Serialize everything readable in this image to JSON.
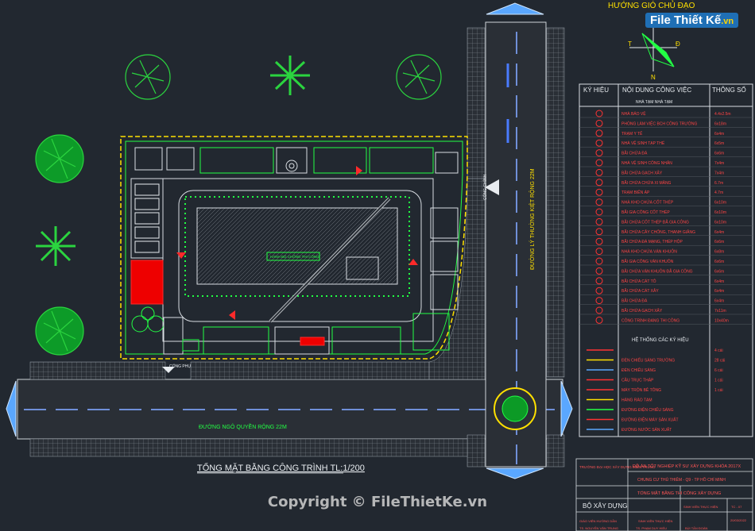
{
  "compass": {
    "title": "HƯỚNG GIÓ CHỦ ĐẠO",
    "west": "T",
    "east": "Đ",
    "south": "N"
  },
  "brand": {
    "name": "File Thiết Kế",
    "suffix": ".vn"
  },
  "legend": {
    "headers": [
      "KÝ HIỆU",
      "NỘI DUNG CÔNG VIỆC",
      "THÔNG SỐ"
    ],
    "subheader": "NHÀ TẠM NHÀ TẠM",
    "rows": [
      {
        "label": "NHÀ BẢO VỆ",
        "value": "4.4x2.5m"
      },
      {
        "label": "PHÒNG LÀM VIỆC BCH CÔNG TRƯỜNG",
        "value": "6x18m"
      },
      {
        "label": "TRẠM Y TẾ",
        "value": "6x4m"
      },
      {
        "label": "NHÀ VỆ SINH TẠP THỂ",
        "value": "6x5m"
      },
      {
        "label": "BÃI CHỨA ĐÁ",
        "value": "6x6m"
      },
      {
        "label": "NHÀ VỆ SINH CÔNG NHÂN",
        "value": "7x4m"
      },
      {
        "label": "BÃI CHỨA GẠCH XÂY",
        "value": "7x4m"
      },
      {
        "label": "BÃI CHỨA CHỨA XI MĂNG",
        "value": "6.7m"
      },
      {
        "label": "TRẠM BIẾN ÁP",
        "value": "4.7m"
      },
      {
        "label": "NHÀ KHO CHỨA CỐT THÉP",
        "value": "6x10m"
      },
      {
        "label": "BÃI GIA CÔNG CỐT THÉP",
        "value": "6x10m"
      },
      {
        "label": "BÃI CHỨA CỐT THÉP ĐÃ GIA CÔNG",
        "value": "6x10m"
      },
      {
        "label": "BÃI CHỨA CÂY CHỐNG, THANH GIẰNG",
        "value": "6x4m"
      },
      {
        "label": "BÃI CHỨA ĐÁ MẠNG, THÉP HỘP",
        "value": "6x6m"
      },
      {
        "label": "NHÀ KHO CHỨA VÁN KHUÔN",
        "value": "6x8m"
      },
      {
        "label": "BÃI GIA CÔNG VÁN KHUÔN",
        "value": "6x6m"
      },
      {
        "label": "BÃI CHỨA VÁN KHUÔN ĐÃ GIA CÔNG",
        "value": "6x6m"
      },
      {
        "label": "BÃI CHỨA CÁT TÔ",
        "value": "6x4m"
      },
      {
        "label": "BÃI CHỨA CÁT XÂY",
        "value": "6x4m"
      },
      {
        "label": "BÃI CHỨA ĐÁ",
        "value": "6x4m"
      },
      {
        "label": "BÃI CHỨA GẠCH XÂY",
        "value": "7x11m"
      },
      {
        "label": "CÔNG TRÌNH ĐANG THI CÔNG",
        "value": "10x40m"
      }
    ],
    "system_header": "HỆ THỐNG CÁC KÝ HIỆU",
    "system_rows": [
      {
        "label": "",
        "value": "4 cái"
      },
      {
        "label": "ĐÈN CHIẾU SÁNG TRƯỜNG",
        "value": "28 cái"
      },
      {
        "label": "ĐÈN CHIẾU SÁNG",
        "value": "6 cái"
      },
      {
        "label": "CẦU TRỤC THÁP",
        "value": "1 cái"
      },
      {
        "label": "MÁY TRỘN BÊ TÔNG",
        "value": "1 cái"
      },
      {
        "label": "HÀNG RÀO TẠM",
        "value": ""
      },
      {
        "label": "ĐƯỜNG ĐIỆN CHIẾU SÁNG",
        "value": ""
      },
      {
        "label": "ĐƯỜNG ĐIỆN MÁY SẢN XUẤT",
        "value": ""
      },
      {
        "label": "ĐƯỜNG NƯỚC SẢN XUẤT",
        "value": ""
      }
    ]
  },
  "site": {
    "road_vertical": "ĐƯỜNG LÝ THƯỜNG KIỆT RỘNG 22M",
    "road_horizontal": "ĐƯỜNG NGÔ QUYỀN RỘNG 22M",
    "building_label": "HÀNH BỘ CHỐNG THI CÔNG",
    "gate_left": "CỔNG PHỤ",
    "gate_right": "CỔNG CHÍNH",
    "drawing_title": "TỔNG MẶT BẰNG CÔNG TRÌNH TL:1/200"
  },
  "title_block": {
    "school": "TRƯỜNG ĐẠI HỌC XÂY DỰNG MIỀN TRUNG",
    "project": "ĐỒ ÁN TỐT NGHIỆP KỸ SƯ XÂY DỰNG KHÓA 2017X",
    "building": "CHUNG CƯ THỦ THIÊM - Q9 - TP HỒ CHÍ MINH",
    "sheet_title": "TỔNG MẶT BẰNG THI CÔNG XÂY DỰNG",
    "ministry": "BỘ XÂY DỰNG",
    "col1": "GIÁO VIÊN HƯỚNG DẪN",
    "col2": "SINH VIÊN THỰC HIỆN",
    "col3": "SINH VIÊN THỰC HIỆN",
    "col4": "TC - 07",
    "name1": "TS. NGUYỄN VĂN TRUNG",
    "name2": "TS. PHẠM DUY HIẾU",
    "name3": "BÙI TẤN ĐOÀN",
    "date": "20/03/2022"
  },
  "copyright": "Copyright © FileThietKe.vn"
}
